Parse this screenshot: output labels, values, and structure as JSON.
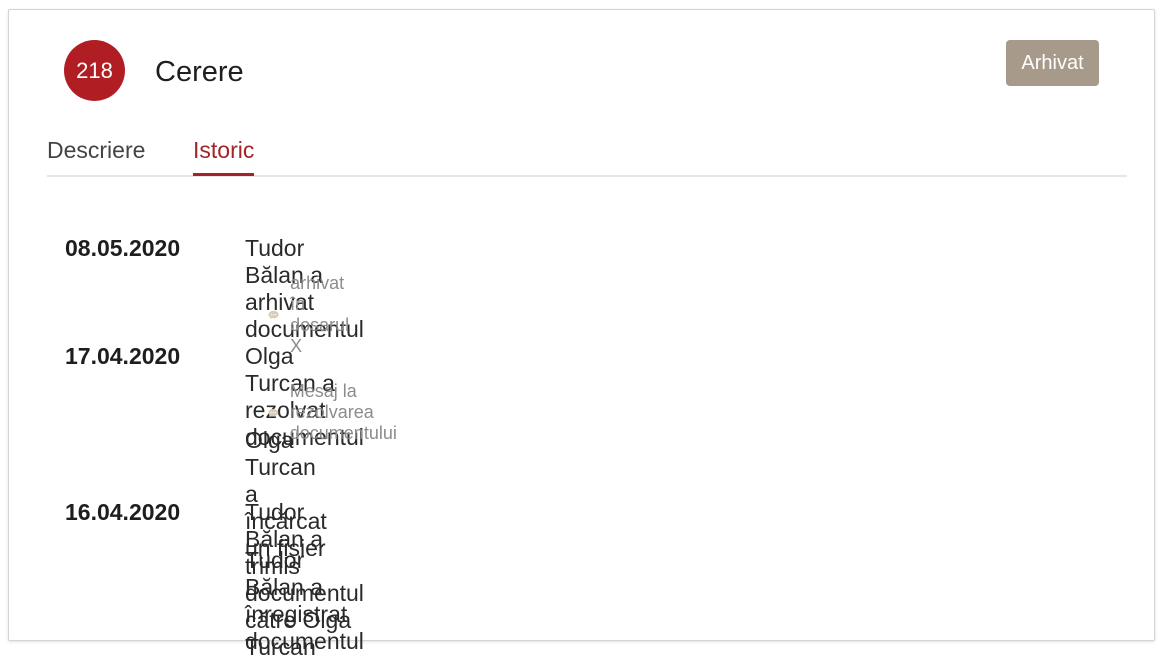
{
  "document": {
    "number": "218",
    "title": "Cerere",
    "status": "Arhivat"
  },
  "tabs": [
    {
      "label": "Descriere",
      "active": false
    },
    {
      "label": "Istoric",
      "active": true
    }
  ],
  "history": [
    {
      "date": "08.05.2020",
      "events": [
        {
          "text": "Tudor Bălan a arhivat documentul",
          "comment": "arhivat în dosarul X"
        }
      ]
    },
    {
      "date": "17.04.2020",
      "events": [
        {
          "text": "Olga Turcan a rezolvat documentul",
          "comment": "Mesaj la rezolvarea documentului"
        },
        {
          "text": "Olga Turcan a încărcat un fișier"
        }
      ]
    },
    {
      "date": "16.04.2020",
      "events": [
        {
          "text": "Tudor Bălan a trimis documentul către Olga Turcan"
        },
        {
          "text": "Tudor Bălan a înregistrat documentul"
        }
      ]
    }
  ],
  "icons": {
    "comment": "speech-bubble-icon"
  },
  "colors": {
    "accent": "#a3232a",
    "number_badge": "#b01e24",
    "status_badge": "#a89a8a",
    "comment_icon": "#d9cbb8"
  }
}
